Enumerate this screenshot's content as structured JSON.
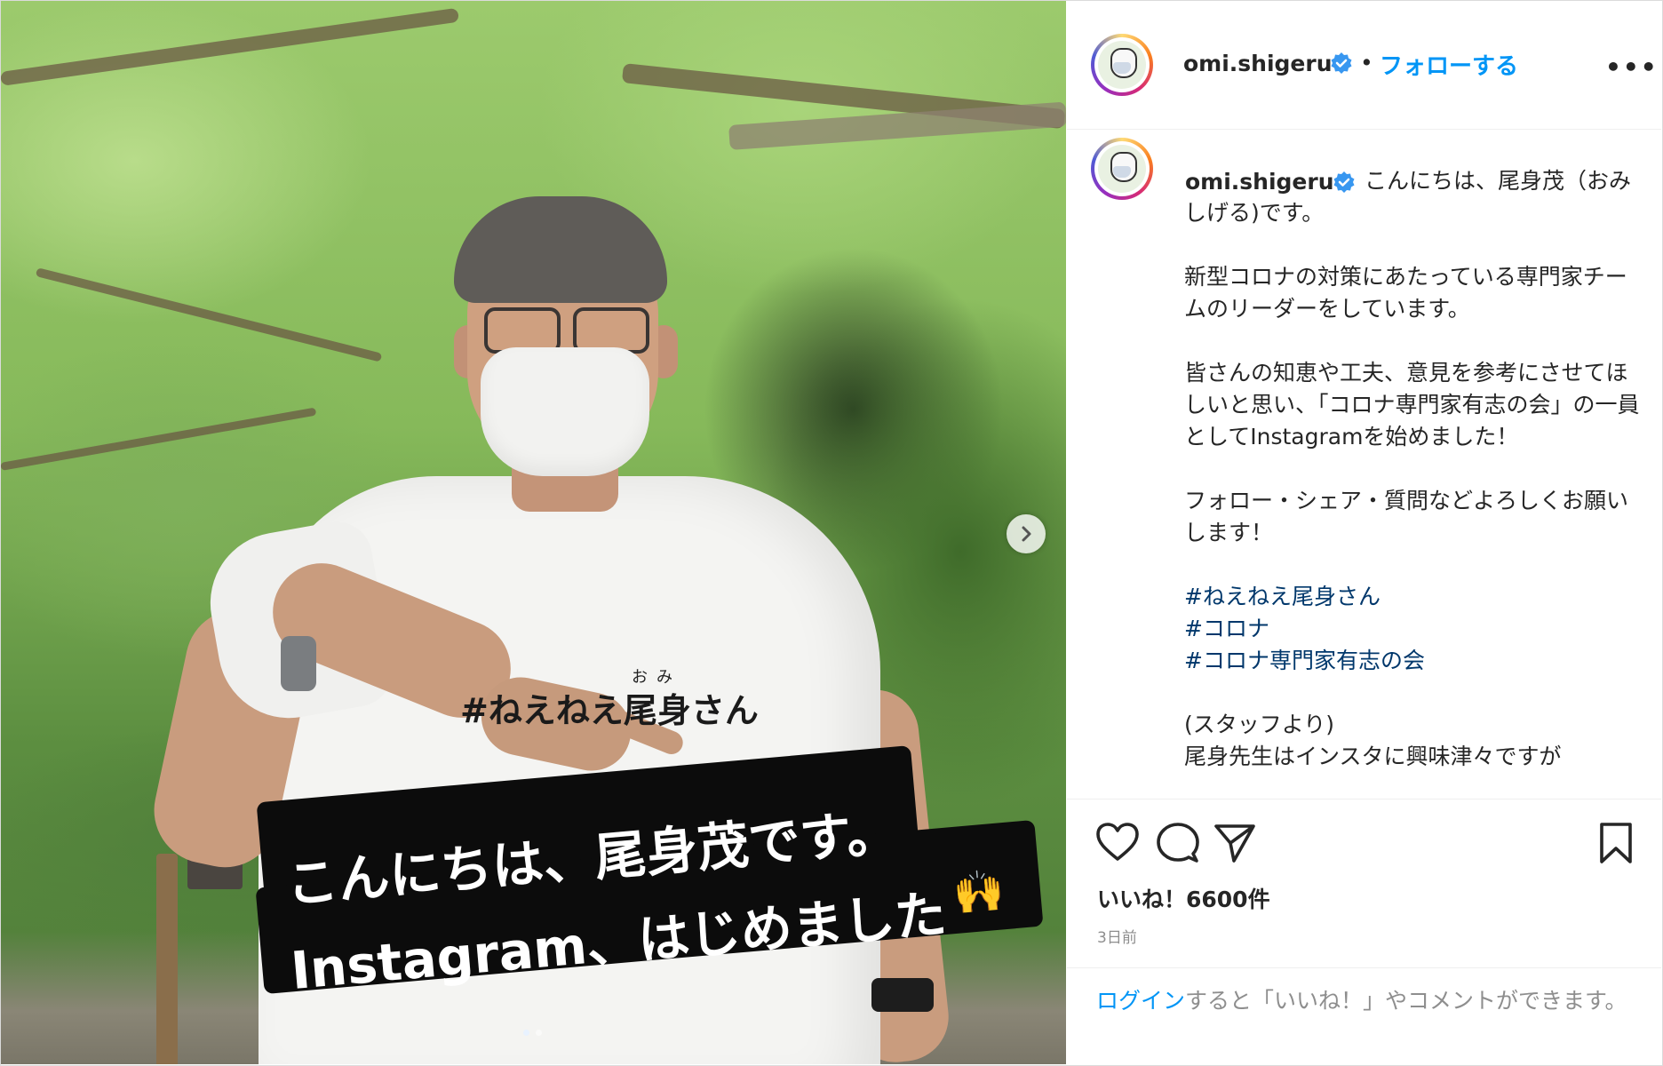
{
  "post": {
    "image": {
      "shirt_furigana": "おみ",
      "shirt_text": "#ねえねえ尾身さん",
      "caption_line1": "こんにちは、尾身茂です。",
      "caption_line2": "Instagram、はじめました",
      "emoji": "🙌",
      "carousel_dots": 2,
      "carousel_active": 0
    },
    "header": {
      "username": "omi.shigeru",
      "verified_icon": "verified-badge-icon",
      "separator": "•",
      "follow_label": "フォローする",
      "more_label": "•••"
    },
    "caption": {
      "username": "omi.shigeru",
      "paragraphs": [
        "こんにちは、尾身茂（おみしげる)です。",
        "新型コロナの対策にあたっている専門家チームのリーダーをしています。",
        "皆さんの知恵や工夫、意見を参考にさせてほしいと思い、「コロナ専門家有志の会」の一員としてInstagramを始めました！",
        "フォロー・シェア・質問などよろしくお願いします！"
      ],
      "hashtags": [
        "#ねえねえ尾身さん",
        "#コロナ",
        "#コロナ専門家有志の会"
      ],
      "staff_note": "(スタッフより)",
      "truncated_line": "尾身先生はインスタに興味津々ですが"
    },
    "actions": {
      "icons": [
        "heart-icon",
        "comment-icon",
        "share-icon",
        "bookmark-icon"
      ],
      "likes_text": "いいね！6600件",
      "time_text": "3日前"
    },
    "login_prompt": {
      "link_text": "ログイン",
      "rest_text": "すると「いいね！」やコメントができます。"
    },
    "colors": {
      "link_blue": "#0095f6",
      "hashtag_blue": "#00376b",
      "text": "#262626",
      "muted": "#8e8e8e",
      "border": "#dbdbdb"
    }
  }
}
